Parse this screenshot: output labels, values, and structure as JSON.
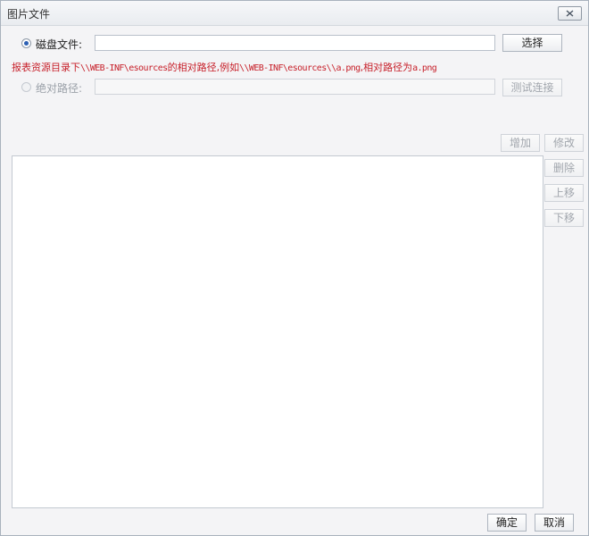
{
  "window": {
    "title": "图片文件"
  },
  "source": {
    "disk_file_label": "磁盘文件:",
    "disk_file_value": "",
    "browse_button": "选择",
    "hint_prefix": "报表资源目录下",
    "hint_path1": "\\\\WEB-INF\\esources",
    "hint_middle": "的相对路径,例如",
    "hint_path2": "\\\\WEB-INF\\esources\\\\a.png",
    "hint_suffix": ",相对路径为",
    "hint_example": "a.png",
    "absolute_path_label": "绝对路径:",
    "absolute_path_value": "",
    "test_connection_button": "测试连接",
    "selected": "disk_file"
  },
  "list_actions": {
    "add": "增加",
    "edit": "修改",
    "delete": "删除",
    "move_up": "上移",
    "move_down": "下移"
  },
  "footer": {
    "ok": "确定",
    "cancel": "取消"
  }
}
